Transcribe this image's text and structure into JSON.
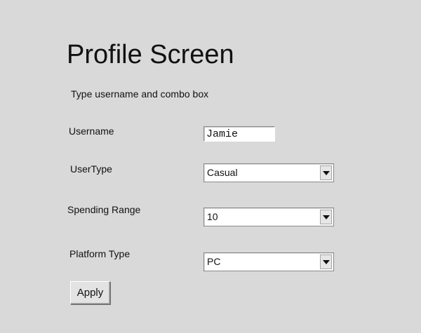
{
  "title": "Profile Screen",
  "subtitle": "Type username and combo box",
  "form": {
    "username": {
      "label": "Username",
      "value": "Jamie"
    },
    "user_type": {
      "label": "UserType",
      "value": "Casual"
    },
    "spending_range": {
      "label": "Spending Range",
      "value": "10"
    },
    "platform_type": {
      "label": "Platform Type",
      "value": "PC"
    }
  },
  "buttons": {
    "apply_label": "Apply"
  },
  "icons": {
    "dropdown": "chevron-down-icon"
  },
  "colors": {
    "background": "#d9d9d9",
    "field_background": "#ffffff"
  }
}
